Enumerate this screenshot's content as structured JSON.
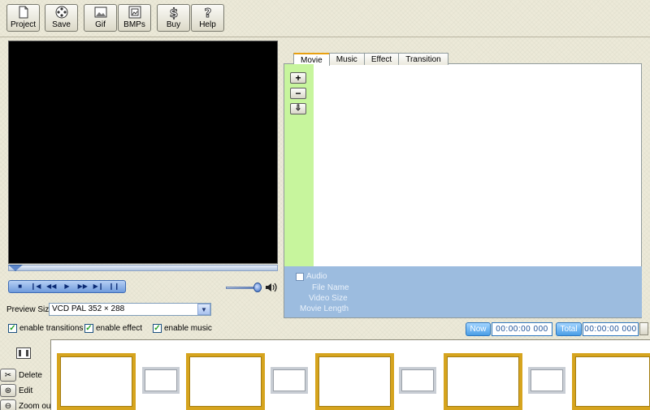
{
  "toolbar": [
    {
      "name": "project-button",
      "icon": "document-icon",
      "label": "Project"
    },
    {
      "name": "save-button",
      "icon": "film-reel-icon",
      "label": "Save"
    },
    {
      "name": "gif-button",
      "icon": "image-icon",
      "label": "Gif"
    },
    {
      "name": "bmps-button",
      "icon": "picture-frame-icon",
      "label": "BMPs"
    },
    {
      "name": "buy-button",
      "icon": "dollar-icon",
      "label": "Buy"
    },
    {
      "name": "help-button",
      "icon": "question-icon",
      "label": "Help"
    }
  ],
  "player": {
    "controls": [
      "stop-icon",
      "frame-back-icon",
      "rewind-icon",
      "play-icon",
      "fast-forward-icon",
      "frame-forward-icon",
      "pause-icon"
    ],
    "volume_level": 0.8
  },
  "preview_size": {
    "label": "Preview Size",
    "value": "VCD PAL 352 × 288"
  },
  "options": [
    {
      "label": "enable transitions",
      "checked": true
    },
    {
      "label": "enable effect",
      "checked": true
    },
    {
      "label": "enable music",
      "checked": true
    }
  ],
  "tabs": [
    {
      "label": "Movie",
      "active": true
    },
    {
      "label": "Music",
      "active": false
    },
    {
      "label": "Effect",
      "active": false
    },
    {
      "label": "Transition",
      "active": false
    }
  ],
  "panel": {
    "add_symbol": "+",
    "remove_symbol": "−",
    "down_symbol": "⇩",
    "audio_label": "Audio",
    "file_name_label": "File Name",
    "video_size_label": "Video Size",
    "movie_length_label": "Movie Length"
  },
  "time": {
    "now_label": "Now",
    "now_value": "00:00:00 000",
    "total_label": "Total",
    "total_value": "00:00:00 000"
  },
  "timeline_actions": [
    {
      "label": "Delete",
      "icon": "scissors-icon"
    },
    {
      "label": "Edit",
      "icon": "film-reel-icon"
    },
    {
      "label": "Zoom out",
      "icon": "zoom-out-icon"
    }
  ],
  "colors": {
    "green_strip": "#c7f59d",
    "info_area": "#9cbcdf",
    "slot_border": "#d6a41e",
    "accent_blue": "#4a9ee6"
  }
}
